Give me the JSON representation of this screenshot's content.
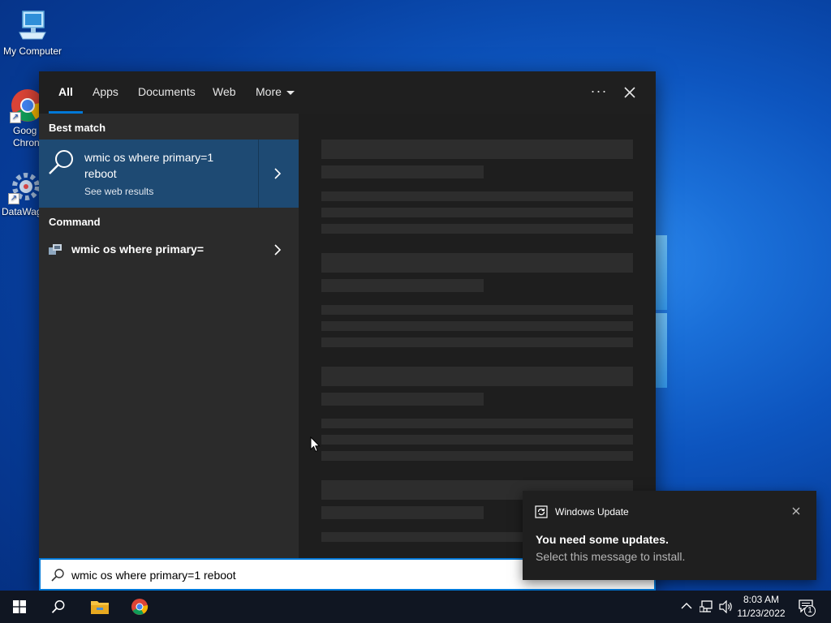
{
  "desktop": {
    "icons": [
      {
        "label": "My Computer"
      },
      {
        "label": "Goog Chron"
      },
      {
        "label": "DataWag"
      }
    ]
  },
  "search_panel": {
    "tabs": [
      {
        "label": "All",
        "active": true
      },
      {
        "label": "Apps"
      },
      {
        "label": "Documents"
      },
      {
        "label": "Web"
      },
      {
        "label": "More"
      }
    ],
    "more_options": "···",
    "best_match": {
      "header": "Best match",
      "title": "wmic os where primary=1 reboot",
      "subtitle": "See web results"
    },
    "command": {
      "header": "Command",
      "item": "wmic os where primary="
    }
  },
  "search_box": {
    "value": "wmic os where primary=1 reboot"
  },
  "toast": {
    "app": "Windows Update",
    "title": "You need some updates.",
    "body": "Select this message to install."
  },
  "taskbar": {
    "time": "8:03 AM",
    "date": "11/23/2022",
    "notification_count": "1"
  },
  "colors": {
    "accent": "#0078d7",
    "panel": "#2b2b2b",
    "best_match_bg": "#1e4a73",
    "taskbar": "#101622"
  }
}
